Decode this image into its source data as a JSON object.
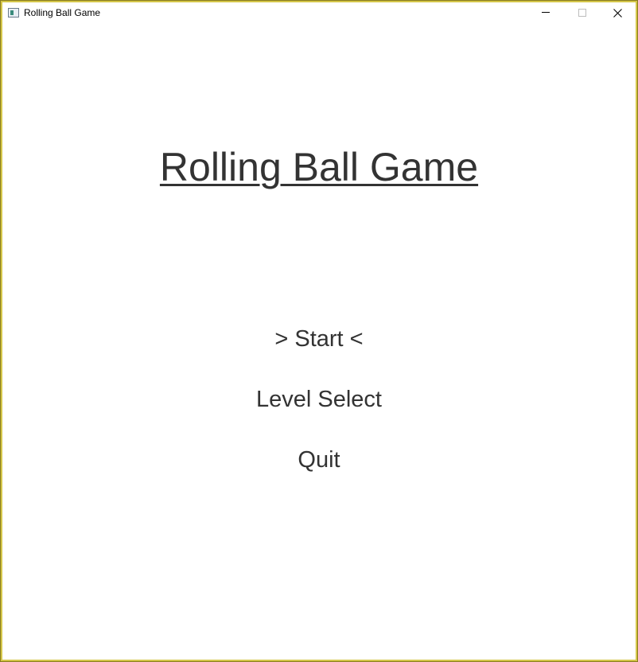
{
  "window": {
    "title": "Rolling Ball Game"
  },
  "game": {
    "title": "Rolling Ball Game",
    "menu": [
      {
        "label": "> Start <",
        "selected": true
      },
      {
        "label": "Level Select",
        "selected": false
      },
      {
        "label": "Quit",
        "selected": false
      }
    ]
  },
  "icons": {
    "app": "app-window-icon",
    "minimize": "minimize-icon",
    "maximize": "maximize-icon",
    "close": "close-icon"
  },
  "colors": {
    "border": "#d4c64a",
    "text": "#333333",
    "background": "#ffffff"
  }
}
